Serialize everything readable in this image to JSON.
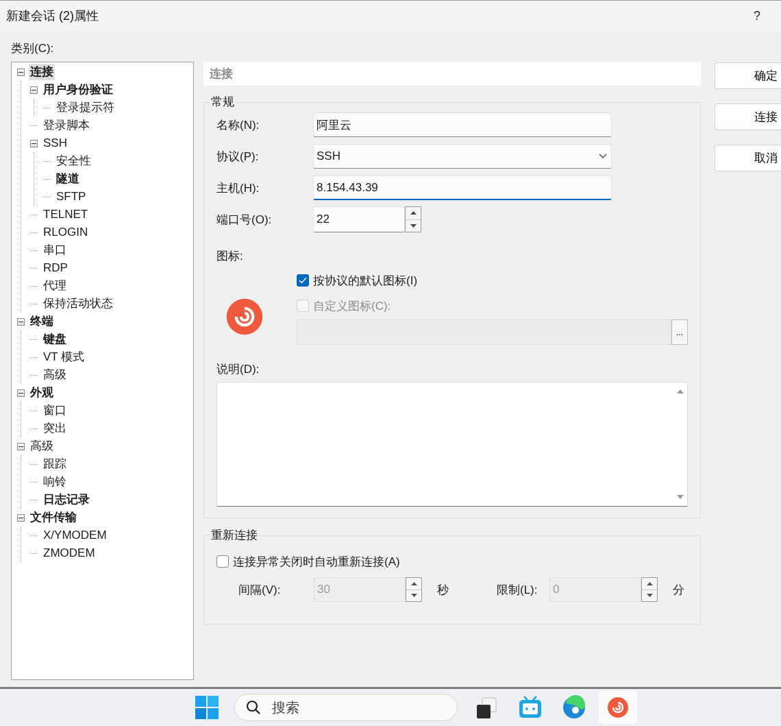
{
  "window": {
    "title": "新建会话 (2)属性",
    "help": "?"
  },
  "category_label": "类别(C):",
  "tree": [
    {
      "label": "连接",
      "bold": true,
      "selected": true,
      "expanded": true,
      "children": [
        {
          "label": "用户身份验证",
          "bold": true,
          "selected": false,
          "expanded": true,
          "children": [
            {
              "label": "登录提示符",
              "bold": false,
              "selected": false
            }
          ]
        },
        {
          "label": "登录脚本",
          "bold": false,
          "selected": false
        },
        {
          "label": "SSH",
          "bold": false,
          "selected": false,
          "expanded": true,
          "children": [
            {
              "label": "安全性",
              "bold": false,
              "selected": false
            },
            {
              "label": "隧道",
              "bold": true,
              "selected": false
            },
            {
              "label": "SFTP",
              "bold": false,
              "selected": false
            }
          ]
        },
        {
          "label": "TELNET",
          "bold": false,
          "selected": false
        },
        {
          "label": "RLOGIN",
          "bold": false,
          "selected": false
        },
        {
          "label": "串口",
          "bold": false,
          "selected": false
        },
        {
          "label": "RDP",
          "bold": false,
          "selected": false
        },
        {
          "label": "代理",
          "bold": false,
          "selected": false
        },
        {
          "label": "保持活动状态",
          "bold": false,
          "selected": false
        }
      ]
    },
    {
      "label": "终端",
      "bold": true,
      "selected": false,
      "expanded": true,
      "children": [
        {
          "label": "键盘",
          "bold": true,
          "selected": false
        },
        {
          "label": "VT 模式",
          "bold": false,
          "selected": false
        },
        {
          "label": "高级",
          "bold": false,
          "selected": false
        }
      ]
    },
    {
      "label": "外观",
      "bold": true,
      "selected": false,
      "expanded": true,
      "children": [
        {
          "label": "窗口",
          "bold": false,
          "selected": false
        },
        {
          "label": "突出",
          "bold": false,
          "selected": false
        }
      ]
    },
    {
      "label": "高级",
      "bold": false,
      "selected": false,
      "expanded": true,
      "children": [
        {
          "label": "跟踪",
          "bold": false,
          "selected": false
        },
        {
          "label": "响铃",
          "bold": false,
          "selected": false
        },
        {
          "label": "日志记录",
          "bold": true,
          "selected": false
        }
      ]
    },
    {
      "label": "文件传输",
      "bold": true,
      "selected": false,
      "expanded": true,
      "children": [
        {
          "label": "X/YMODEM",
          "bold": false,
          "selected": false
        },
        {
          "label": "ZMODEM",
          "bold": false,
          "selected": false
        }
      ]
    }
  ],
  "panel": {
    "header": "连接",
    "general": {
      "legend": "常规",
      "fields": [
        {
          "kind": "text",
          "label": "名称(N):",
          "value": "阿里云",
          "focused": false
        },
        {
          "kind": "select",
          "label": "协议(P):",
          "value": "SSH",
          "focused": false
        },
        {
          "kind": "text",
          "label": "主机(H):",
          "value": "8.154.43.39",
          "focused": true
        },
        {
          "kind": "spin",
          "label": "端口号(O):",
          "value": "22",
          "focused": false
        }
      ],
      "icon_label": "图标:",
      "icon_options": [
        {
          "label": "按协议的默认图标(I)",
          "checked": true,
          "disabled": false
        },
        {
          "label": "自定义图标(C):",
          "checked": false,
          "disabled": true
        }
      ],
      "browse_button": "...",
      "description_label": "说明(D):"
    },
    "reconnect": {
      "legend": "重新连接",
      "checkbox": {
        "label": "连接异常关闭时自动重新连接(A)",
        "checked": false
      },
      "settings": [
        {
          "label": "间隔(V):",
          "value": "30",
          "unit": "秒",
          "disabled": true
        },
        {
          "label": "限制(L):",
          "value": "0",
          "unit": "分",
          "disabled": true
        }
      ]
    }
  },
  "buttons": [
    "确定",
    "连接",
    "取消"
  ],
  "taskbar": {
    "search_placeholder": "搜索",
    "apps": [
      {
        "kind": "task-view",
        "active": false
      },
      {
        "kind": "tv",
        "active": false
      },
      {
        "kind": "browser",
        "active": false
      },
      {
        "kind": "terminal",
        "active": true
      }
    ]
  }
}
